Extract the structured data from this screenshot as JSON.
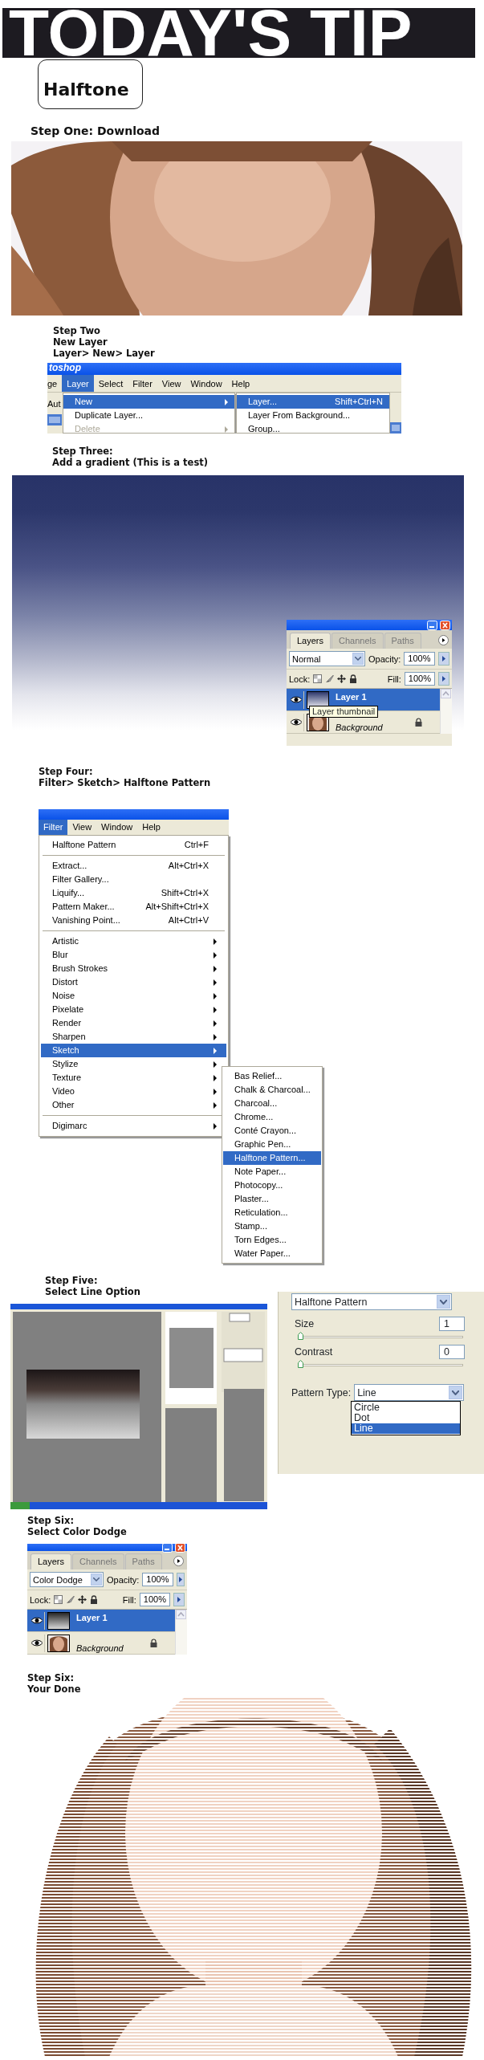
{
  "banner": {
    "title": "TODAY'S TIP"
  },
  "badge": {
    "label": "Halftone"
  },
  "step_one": {
    "heading": [
      "Step One: Download"
    ]
  },
  "step_two": {
    "heading": [
      "Step Two",
      "New Layer",
      "Layer> New> Layer"
    ],
    "app_title": "toshop",
    "toolbar_label": "Aut",
    "menu_bar": [
      {
        "label": "ge",
        "selected": false
      },
      {
        "label": "Layer",
        "selected": true
      },
      {
        "label": "Select",
        "selected": false
      },
      {
        "label": "Filter",
        "selected": false
      },
      {
        "label": "View",
        "selected": false
      },
      {
        "label": "Window",
        "selected": false
      },
      {
        "label": "Help",
        "selected": false
      }
    ],
    "menu": [
      {
        "label": "New",
        "kind": "submenu",
        "selected": true,
        "disabled": false
      },
      {
        "label": "Duplicate Layer...",
        "kind": "item",
        "selected": false,
        "disabled": false
      },
      {
        "label": "Delete",
        "kind": "submenu",
        "selected": false,
        "disabled": true
      }
    ],
    "submenu": [
      {
        "label": "Layer...",
        "shortcut": "Shift+Ctrl+N",
        "selected": true
      },
      {
        "label": "Layer From Background...",
        "selected": false
      },
      {
        "label": "Group...",
        "selected": false
      }
    ]
  },
  "step_three": {
    "heading": [
      "Step Three:",
      "Add a gradient (This is a test)"
    ],
    "layers_panel": {
      "tabs": [
        {
          "label": "Layers",
          "selected": true
        },
        {
          "label": "Channels",
          "selected": false
        },
        {
          "label": "Paths",
          "selected": false
        }
      ],
      "blend_mode": "Normal",
      "opacity_label": "Opacity:",
      "opacity": "100%",
      "lock_label": "Lock:",
      "fill_label": "Fill:",
      "fill": "100%",
      "layers": [
        {
          "name": "Layer 1",
          "kind": "navy",
          "selected": true,
          "locked": false
        },
        {
          "name": "Background",
          "selected": false,
          "locked": true
        }
      ],
      "tooltip": "Layer thumbnail"
    }
  },
  "step_four": {
    "heading": [
      "Step Four:",
      "Filter> Sketch> Halftone Pattern"
    ],
    "menu_bar": [
      {
        "label": "Filter",
        "selected": true
      },
      {
        "label": "View",
        "selected": false
      },
      {
        "label": "Window",
        "selected": false
      },
      {
        "label": "Help",
        "selected": false
      }
    ],
    "menu": [
      {
        "kind": "item",
        "label": "Halftone Pattern",
        "shortcut": "Ctrl+F",
        "selected": false
      },
      {
        "kind": "separator"
      },
      {
        "kind": "item",
        "label": "Extract...",
        "shortcut": "Alt+Ctrl+X",
        "selected": false
      },
      {
        "kind": "item",
        "label": "Filter Gallery...",
        "selected": false
      },
      {
        "kind": "item",
        "label": "Liquify...",
        "shortcut": "Shift+Ctrl+X",
        "selected": false
      },
      {
        "kind": "item",
        "label": "Pattern Maker...",
        "shortcut": "Alt+Shift+Ctrl+X",
        "selected": false
      },
      {
        "kind": "item",
        "label": "Vanishing Point...",
        "shortcut": "Alt+Ctrl+V",
        "selected": false
      },
      {
        "kind": "separator"
      },
      {
        "kind": "submenu",
        "label": "Artistic",
        "selected": false
      },
      {
        "kind": "submenu",
        "label": "Blur",
        "selected": false
      },
      {
        "kind": "submenu",
        "label": "Brush Strokes",
        "selected": false
      },
      {
        "kind": "submenu",
        "label": "Distort",
        "selected": false
      },
      {
        "kind": "submenu",
        "label": "Noise",
        "selected": false
      },
      {
        "kind": "submenu",
        "label": "Pixelate",
        "selected": false
      },
      {
        "kind": "submenu",
        "label": "Render",
        "selected": false
      },
      {
        "kind": "submenu",
        "label": "Sharpen",
        "selected": false
      },
      {
        "kind": "submenu",
        "label": "Sketch",
        "selected": true
      },
      {
        "kind": "submenu",
        "label": "Stylize",
        "selected": false
      },
      {
        "kind": "submenu",
        "label": "Texture",
        "selected": false
      },
      {
        "kind": "submenu",
        "label": "Video",
        "selected": false
      },
      {
        "kind": "submenu",
        "label": "Other",
        "selected": false
      },
      {
        "kind": "separator"
      },
      {
        "kind": "submenu",
        "label": "Digimarc",
        "selected": false
      }
    ],
    "submenu": [
      {
        "label": "Bas Relief...",
        "selected": false
      },
      {
        "label": "Chalk & Charcoal...",
        "selected": false
      },
      {
        "label": "Charcoal...",
        "selected": false
      },
      {
        "label": "Chrome...",
        "selected": false
      },
      {
        "label": "Conté Crayon...",
        "selected": false
      },
      {
        "label": "Graphic Pen...",
        "selected": false
      },
      {
        "label": "Halftone Pattern...",
        "selected": true
      },
      {
        "label": "Note Paper...",
        "selected": false
      },
      {
        "label": "Photocopy...",
        "selected": false
      },
      {
        "label": "Plaster...",
        "selected": false
      },
      {
        "label": "Reticulation...",
        "selected": false
      },
      {
        "label": "Stamp...",
        "selected": false
      },
      {
        "label": "Torn Edges...",
        "selected": false
      },
      {
        "label": "Water Paper...",
        "selected": false
      }
    ]
  },
  "step_five": {
    "heading": [
      "Step Five:",
      "Select Line Option"
    ],
    "options": {
      "filter": "Halftone Pattern",
      "sliders": [
        {
          "label": "Size",
          "value": "1",
          "level": 0
        },
        {
          "label": "Contrast",
          "value": "0",
          "level": 0
        }
      ],
      "pattern_type": {
        "label": "Pattern Type:",
        "value": "Line",
        "options": [
          {
            "label": "Circle",
            "selected": false
          },
          {
            "label": "Dot",
            "selected": false
          },
          {
            "label": "Line",
            "selected": true
          }
        ]
      }
    }
  },
  "step_six": {
    "heading": [
      "Step Six:",
      "Select Color Dodge"
    ],
    "layers_panel": {
      "tabs": [
        {
          "label": "Layers",
          "selected": true
        },
        {
          "label": "Channels",
          "selected": false
        },
        {
          "label": "Paths",
          "selected": false
        }
      ],
      "blend_mode": "Color Dodge",
      "opacity_label": "Opacity:",
      "opacity": "100%",
      "lock_label": "Lock:",
      "fill_label": "Fill:",
      "fill": "100%",
      "layers": [
        {
          "name": "Layer 1",
          "kind": "gray",
          "selected": true,
          "locked": false
        },
        {
          "name": "Background",
          "selected": false,
          "locked": true
        }
      ]
    }
  },
  "step_done": {
    "heading": [
      "Step Six:",
      "Your Done"
    ]
  }
}
